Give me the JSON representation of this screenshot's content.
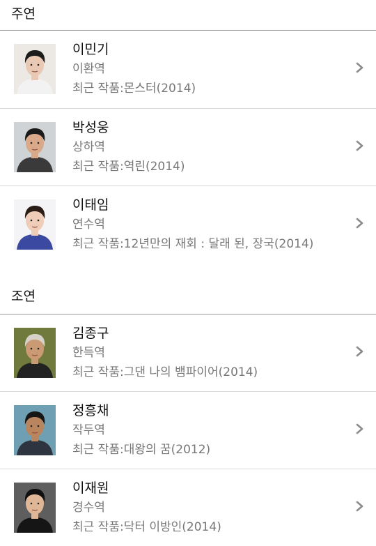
{
  "sections": [
    {
      "title": "주연",
      "people": [
        {
          "name": "이민기",
          "role": "이환역",
          "recent": "최근 작품:몬스터(2014)",
          "photo_bg": "#ece8e4",
          "skin": "#e9c9b3",
          "hair": "#1c1c1c",
          "cloth": "#f2f2f2"
        },
        {
          "name": "박성웅",
          "role": "상하역",
          "recent": "최근 작품:역린(2014)",
          "photo_bg": "#cfd3d6",
          "skin": "#d9a98a",
          "hair": "#1a1a1a",
          "cloth": "#3a3a3a"
        },
        {
          "name": "이태임",
          "role": "연수역",
          "recent": "최근 작품:12년만의 재회 : 달래 된, 장국(2014)",
          "photo_bg": "#f4f4f6",
          "skin": "#f0cdb8",
          "hair": "#2a1d16",
          "cloth": "#3b49a0"
        }
      ]
    },
    {
      "title": "조연",
      "people": [
        {
          "name": "김종구",
          "role": "한득역",
          "recent": "최근 작품:그댄 나의 뱀파이어(2014)",
          "photo_bg": "#6f7a3c",
          "skin": "#c99a74",
          "hair": "#d6d2cb",
          "cloth": "#222222"
        },
        {
          "name": "정흥채",
          "role": "작두역",
          "recent": "최근 작품:대왕의 꿈(2012)",
          "photo_bg": "#6f9fb3",
          "skin": "#b9855f",
          "hair": "#161616",
          "cloth": "#2f3540"
        },
        {
          "name": "이재원",
          "role": "경수역",
          "recent": "최근 작품:닥터 이방인(2014)",
          "photo_bg": "#5e5e5e",
          "skin": "#e0b796",
          "hair": "#101010",
          "cloth": "#151515"
        }
      ]
    }
  ]
}
